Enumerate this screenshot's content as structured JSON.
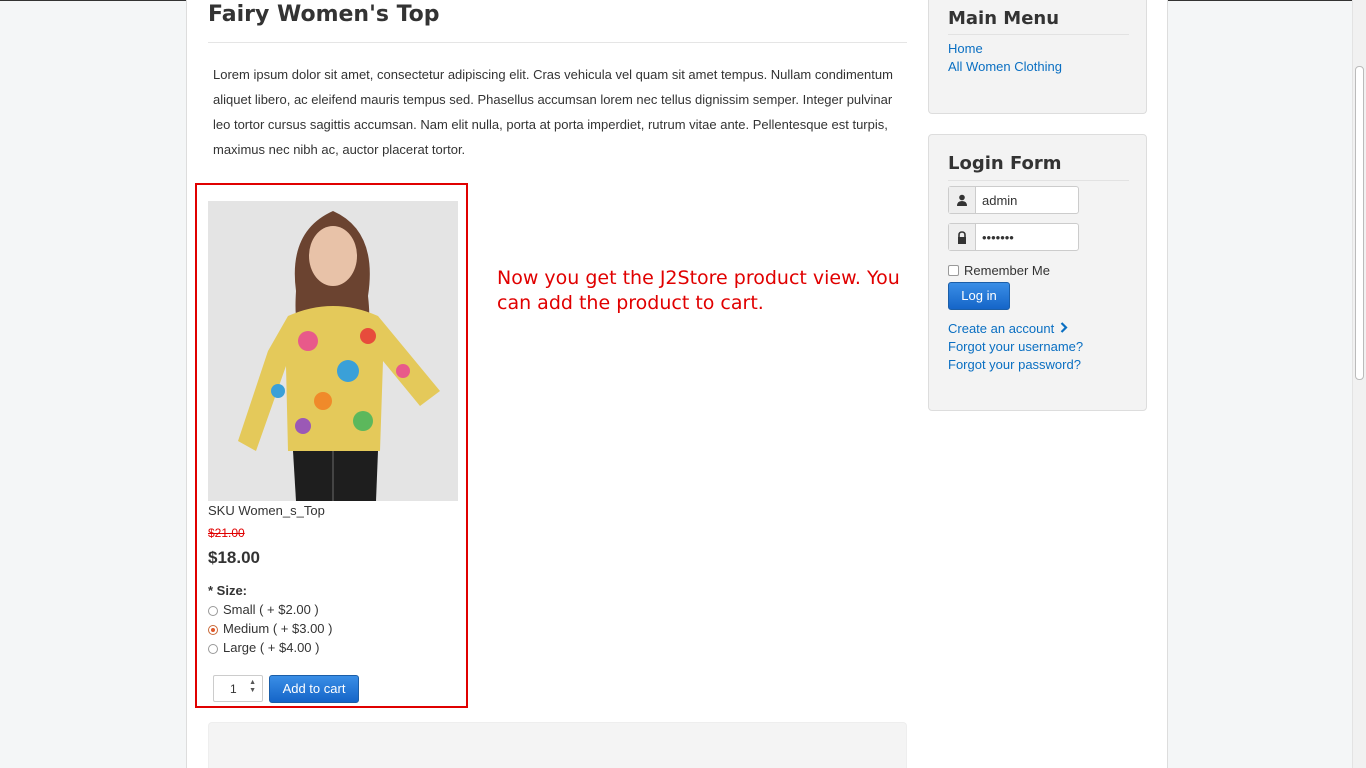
{
  "article": {
    "title": "Fairy Women's Top",
    "description": "Lorem ipsum dolor sit amet, consectetur adipiscing elit. Cras vehicula vel quam sit amet tempus. Nullam condimentum aliquet libero, ac eleifend mauris tempus sed. Phasellus accumsan lorem nec tellus dignissim semper. Integer pulvinar leo tortor cursus sagittis accumsan. Nam elit nulla, porta at porta imperdiet, rutrum vitae ante. Pellentesque est turpis, maximus nec nibh ac, auctor placerat tortor."
  },
  "product": {
    "sku": "SKU Women_s_Top",
    "old_price": "$21.00",
    "price": "$18.00",
    "size_label": "* Size:",
    "options": [
      {
        "label": "Small ( + $2.00 )",
        "selected": false
      },
      {
        "label": "Medium ( + $3.00 )",
        "selected": true
      },
      {
        "label": "Large ( + $4.00 )",
        "selected": false
      }
    ],
    "quantity": "1",
    "add_to_cart_label": "Add to cart"
  },
  "annotation": "Now you get the J2Store product view. You can add the product to cart.",
  "main_menu": {
    "title": "Main Menu",
    "items": [
      "Home",
      "All Women Clothing"
    ]
  },
  "login_form": {
    "title": "Login Form",
    "username_value": "admin",
    "password_value": "•••••••",
    "remember_label": "Remember Me",
    "login_label": "Log in",
    "links": [
      "Create an account",
      "Forgot your username?",
      "Forgot your password?"
    ]
  },
  "colors": {
    "annotation": "#e00000",
    "link": "#0a6fc2",
    "button": "#1565c8"
  }
}
